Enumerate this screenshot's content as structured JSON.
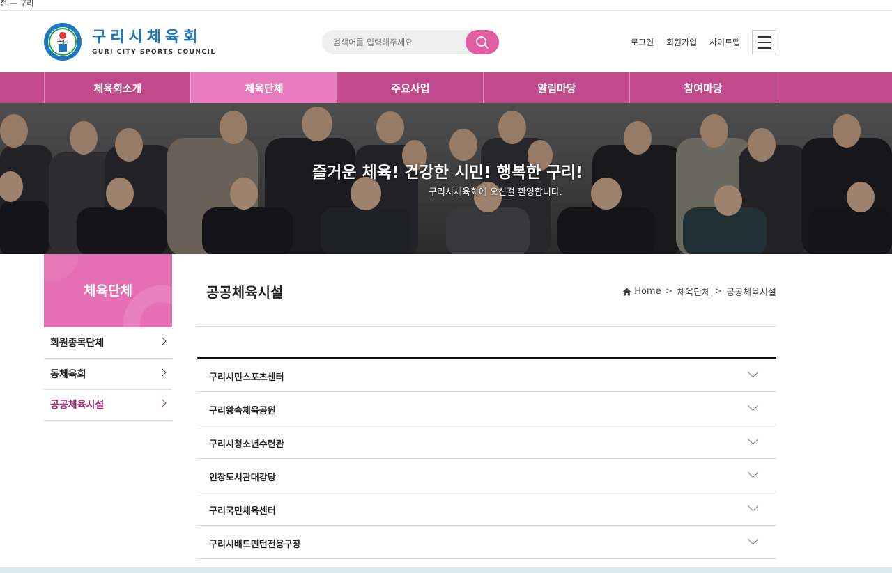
{
  "topstrip": {
    "text": "전 — 구리"
  },
  "header": {
    "logo_title": "구리시체육회",
    "logo_sub": "GURI CITY SPORTS COUNCIL",
    "logo_emblem_label": "구리시",
    "search_placeholder": "검색어를 입력해주세요",
    "util_links": [
      "로그인",
      "회원가입",
      "사이트맵"
    ]
  },
  "nav": {
    "items": [
      "체육회소개",
      "체육단체",
      "주요사업",
      "알림마당",
      "참여마당"
    ],
    "active_index": 1
  },
  "banner": {
    "title": "즐거운 체육! 건강한 시민! 행복한 구리!",
    "subtitle": "구리시체육회에 오신걸 환영합니다."
  },
  "sidebar": {
    "heading": "체육단체",
    "items": [
      "회원종목단체",
      "동체육회",
      "공공체육시설"
    ],
    "active_index": 2
  },
  "content": {
    "page_title": "공공체육시설",
    "breadcrumb": [
      "Home",
      "체육단체",
      "공공체육시설"
    ],
    "facilities": [
      "구리시민스포츠센터",
      "구리왕숙체육공원",
      "구리시청소년수련관",
      "인창도서관대강당",
      "구리국민체육센터",
      "구리시배드민턴전용구장"
    ]
  },
  "colors": {
    "brand_blue": "#1e77bd",
    "nav_bg": "#c14a8c",
    "nav_active": "#e87cbf",
    "search_button": "#e25fa4",
    "sidebar_head": "#e46fb3",
    "sidebar_active_text": "#a52a78"
  }
}
